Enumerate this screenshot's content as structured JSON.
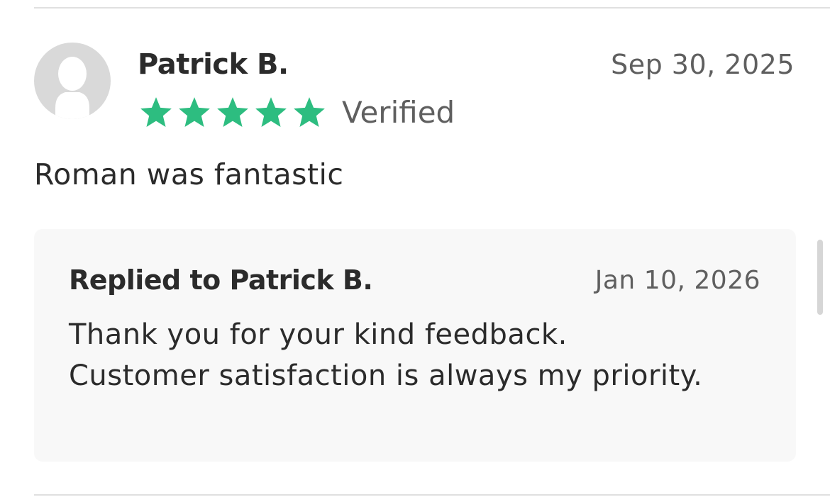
{
  "review": {
    "reviewer_name": "Patrick B.",
    "date": "Sep 30, 2025",
    "rating": 5,
    "rating_max": 5,
    "verified_label": "Verified",
    "text": "Roman was fantastic",
    "avatar_icon": "user-silhouette-icon",
    "star_icon": "star-icon",
    "star_color": "#2dbd80"
  },
  "reply": {
    "title": "Replied to Patrick B.",
    "date": "Jan 10, 2026",
    "text": "Thank you for your kind feedback. Customer satisfaction is always my priority."
  },
  "colors": {
    "background": "#ffffff",
    "reply_background": "#f8f8f8",
    "primary_text": "#2b2b2b",
    "secondary_text": "#5f5f5f",
    "divider": "#e0e0e0",
    "avatar_bg": "#d9d9d9",
    "avatar_fg": "#ffffff"
  }
}
